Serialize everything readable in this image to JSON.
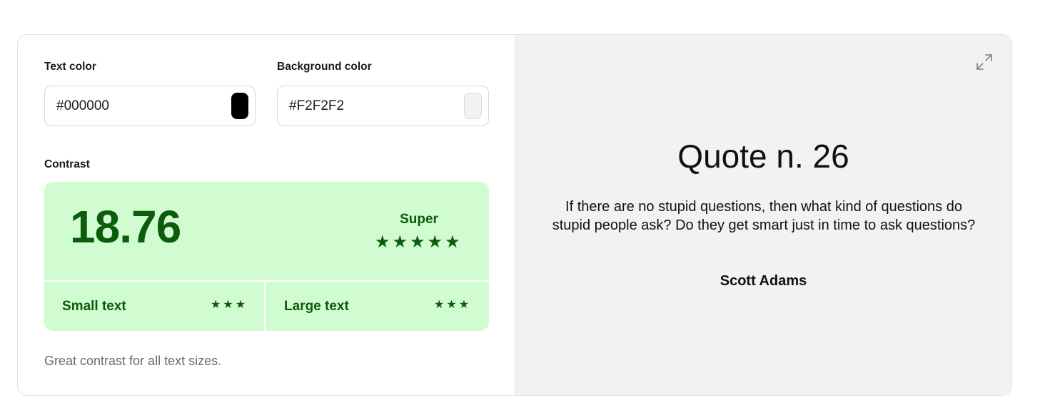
{
  "inputs": {
    "text_color_label": "Text color",
    "text_color_value": "#000000",
    "text_color_swatch": "#000000",
    "bg_color_label": "Background color",
    "bg_color_value": "#F2F2F2",
    "bg_color_swatch": "#F2F2F2"
  },
  "contrast": {
    "label": "Contrast",
    "ratio": "18.76",
    "rating": "Super",
    "rating_stars": 5,
    "small_text_label": "Small text",
    "small_text_stars": 3,
    "large_text_label": "Large text",
    "large_text_stars": 3,
    "note": "Great contrast for all text sizes."
  },
  "preview": {
    "title": "Quote n. 26",
    "quote": "If there are no stupid questions, then what kind of questions do stupid people ask? Do they get smart just in time to ask questions?",
    "author": "Scott Adams",
    "expand_icon": "expand-icon"
  },
  "colors": {
    "good_bg": "#d1fbd0",
    "good_fg": "#0b5c0b",
    "preview_bg": "#f2f2f2",
    "border": "#e2e2e2"
  }
}
